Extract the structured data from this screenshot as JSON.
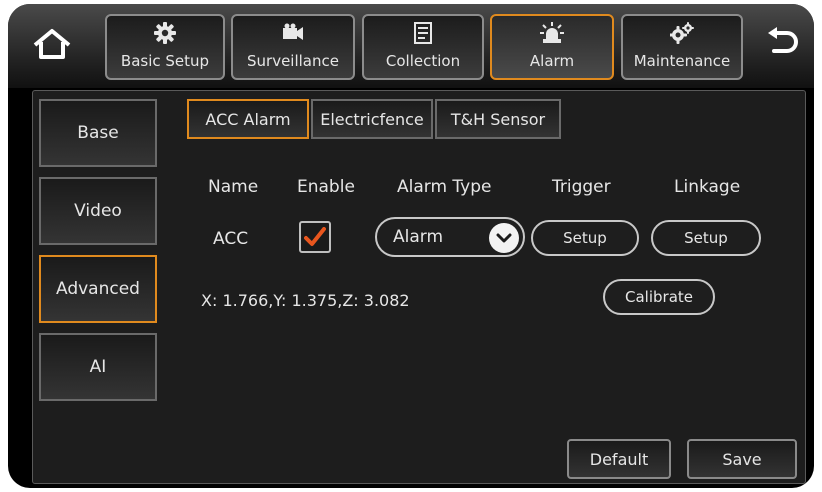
{
  "topbar": {
    "home_icon": "home-icon",
    "back_icon": "back-arrow-icon",
    "tabs": [
      {
        "label": "Basic Setup",
        "icon": "gear-icon"
      },
      {
        "label": "Surveillance",
        "icon": "camera-icon"
      },
      {
        "label": "Collection",
        "icon": "document-icon"
      },
      {
        "label": "Alarm",
        "icon": "alarm-light-icon"
      },
      {
        "label": "Maintenance",
        "icon": "gears-icon"
      }
    ],
    "active_tab": "Alarm"
  },
  "sidebar": {
    "items": [
      {
        "label": "Base"
      },
      {
        "label": "Video"
      },
      {
        "label": "Advanced"
      },
      {
        "label": "AI"
      }
    ],
    "active_item": "Advanced"
  },
  "subtabs": {
    "items": [
      {
        "label": "ACC Alarm"
      },
      {
        "label": "Electricfence"
      },
      {
        "label": "T&H Sensor"
      }
    ],
    "active": "ACC Alarm"
  },
  "table": {
    "headers": {
      "name": "Name",
      "enable": "Enable",
      "alarm_type": "Alarm Type",
      "trigger": "Trigger",
      "linkage": "Linkage"
    },
    "row": {
      "name": "ACC",
      "enabled": true,
      "alarm_type": "Alarm",
      "trigger_button": "Setup",
      "linkage_button": "Setup"
    }
  },
  "sensor": {
    "readout": "X: 1.766,Y: 1.375,Z: 3.082",
    "calibrate_button": "Calibrate"
  },
  "footer": {
    "default_button": "Default",
    "save_button": "Save"
  },
  "colors": {
    "accent": "#e08a1e",
    "checkmark": "#e8561e",
    "background": "#000000",
    "panel": "#1d1d1d"
  }
}
